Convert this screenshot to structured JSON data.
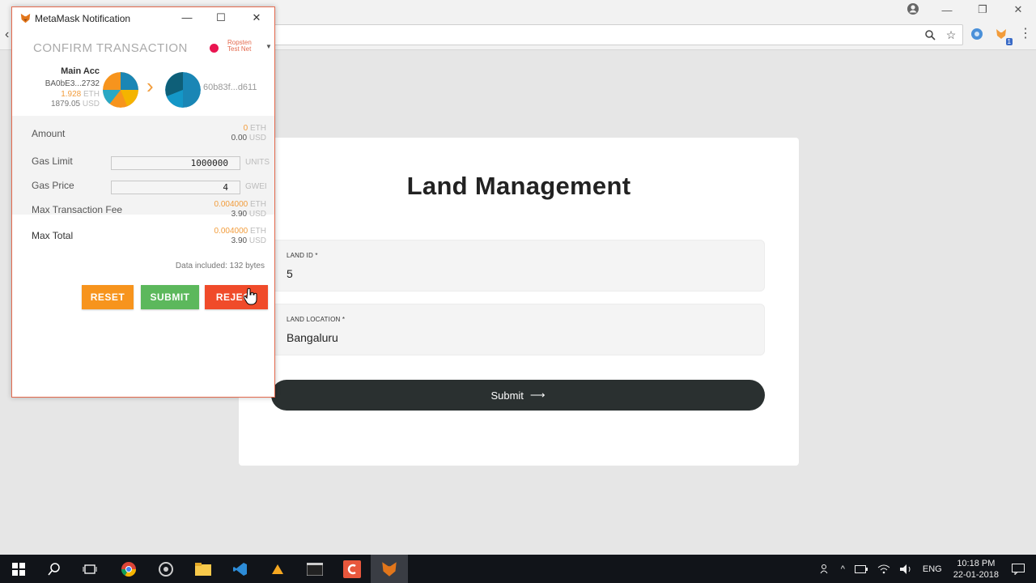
{
  "browser": {
    "window_controls": [
      "—",
      "❐",
      "✕"
    ],
    "extension_badge": "1"
  },
  "page": {
    "title": "Land Management",
    "fields": [
      {
        "label": "LAND ID *",
        "value": "5"
      },
      {
        "label": "LAND LOCATION *",
        "value": "Bangaluru"
      }
    ],
    "submit_label": "Submit",
    "submit_arrow": "⟶"
  },
  "metamask": {
    "window_title": "MetaMask Notification",
    "header": "CONFIRM TRANSACTION",
    "network_line1": "Ropsten",
    "network_line2": "Test Net",
    "network_color": "#e91550",
    "from": {
      "name": "Main Acc",
      "address": "BA0bE3...2732",
      "eth_amount": "1.928",
      "eth_unit": "ETH",
      "usd_amount": "1879.05",
      "usd_unit": "USD"
    },
    "to_address": "60b83f...d611",
    "amount": {
      "label": "Amount",
      "eth": "0",
      "eth_unit": "ETH",
      "usd": "0.00",
      "usd_unit": "USD"
    },
    "gas_limit": {
      "label": "Gas Limit",
      "value": "1000000",
      "unit": "UNITS"
    },
    "gas_price": {
      "label": "Gas Price",
      "value": "4",
      "unit": "GWEI"
    },
    "max_fee": {
      "label": "Max Transaction Fee",
      "eth": "0.004000",
      "eth_unit": "ETH",
      "usd": "3.90",
      "usd_unit": "USD"
    },
    "max_total": {
      "label": "Max Total",
      "eth": "0.004000",
      "eth_unit": "ETH",
      "usd": "3.90",
      "usd_unit": "USD"
    },
    "data_included": "Data included: 132 bytes",
    "buttons": {
      "reset": "RESET",
      "submit": "SUBMIT",
      "reject": "REJECT"
    },
    "accent_colors": {
      "reset": "#f7941d",
      "submit": "#5cb85c",
      "reject": "#f04b2a"
    }
  },
  "taskbar": {
    "language": "ENG",
    "time": "10:18 PM",
    "date": "22-01-2018"
  }
}
